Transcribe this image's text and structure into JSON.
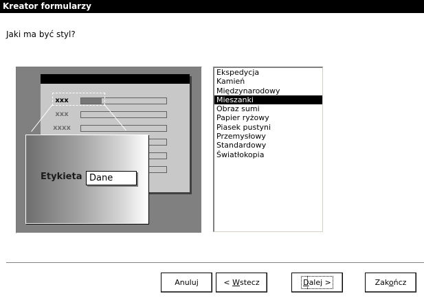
{
  "window": {
    "title": "Kreator formularzy"
  },
  "prompt": "Jaki ma być styl?",
  "preview": {
    "rows": [
      "xxx",
      "xxx",
      "xxxx"
    ],
    "zoom_label": "Etykieta",
    "zoom_field": "Dane"
  },
  "styles": {
    "items": [
      "Ekspedycja",
      "Kamień",
      "Międzynarodowy",
      "Mieszanki",
      "Obraz sumi",
      "Papier ryżowy",
      "Piasek pustyni",
      "Przemysłowy",
      "Standardowy",
      "Światłokopia"
    ],
    "selected_index": 3
  },
  "buttons": {
    "cancel": "Anuluj",
    "back_pre": "< ",
    "back_key": "W",
    "back_post": "stecz",
    "next_key": "D",
    "next_post": "alej >",
    "finish_pre": "Zak",
    "finish_key": "o",
    "finish_post": "ńcz"
  }
}
